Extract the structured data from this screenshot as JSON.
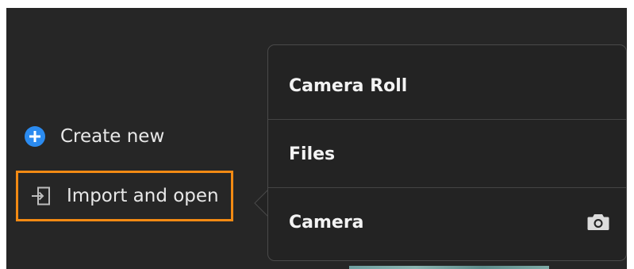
{
  "sidebar": {
    "create_new": {
      "label": "Create new",
      "icon": "plus-circle-icon",
      "accent": "#2b8bf0"
    },
    "import_open": {
      "label": "Import and open",
      "icon": "import-icon",
      "highlight": "#f28a13"
    }
  },
  "import_menu": {
    "items": [
      {
        "label": "Camera Roll"
      },
      {
        "label": "Files"
      },
      {
        "label": "Camera",
        "icon": "camera-icon"
      }
    ]
  }
}
